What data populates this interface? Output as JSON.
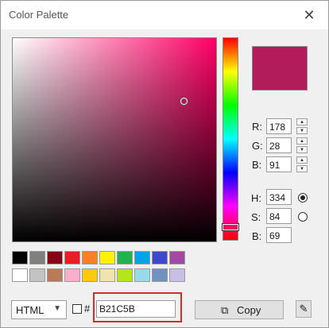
{
  "window": {
    "title": "Color Palette",
    "close_label": "✕"
  },
  "current_color": "#B21C5B",
  "hue_color": "#ff0066",
  "sv_marker": {
    "saturation": 0.84,
    "value": 0.69
  },
  "hue_position": 0.93,
  "rgb": [
    {
      "label": "R:",
      "value": "178"
    },
    {
      "label": "G:",
      "value": "28"
    },
    {
      "label": "B:",
      "value": "91"
    }
  ],
  "hsb": [
    {
      "label": "H:",
      "value": "334",
      "radio": true,
      "selected": true
    },
    {
      "label": "S:",
      "value": "84",
      "radio": true,
      "selected": false
    },
    {
      "label": "B:",
      "value": "69",
      "radio": false,
      "selected": false
    }
  ],
  "swatches": [
    [
      "#000000",
      "#7f7f7f",
      "#880015",
      "#ed1c24",
      "#ff7f27",
      "#fff200",
      "#22b14c",
      "#00a2e8",
      "#3f48cc",
      "#a349a4"
    ],
    [
      "#ffffff",
      "#c3c3c3",
      "#b97a57",
      "#ffaec9",
      "#ffc90e",
      "#efe4b0",
      "#b5e61d",
      "#99d9ea",
      "#7092be",
      "#c8bfe7"
    ]
  ],
  "footer": {
    "format": "HTML",
    "hash": "#",
    "hex_value": "B21C5B",
    "copy_label": "Copy",
    "copy_icon": "copy-icon",
    "picker_icon": "eyedropper-icon"
  }
}
